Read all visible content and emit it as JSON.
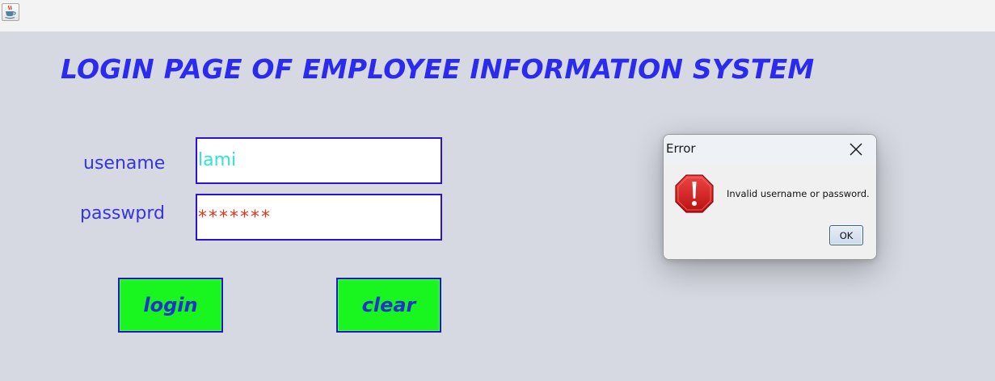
{
  "window": {
    "app_icon": "java-cup-icon"
  },
  "form": {
    "title": "LOGIN PAGE OF EMPLOYEE INFORMATION SYSTEM",
    "username_label": "usename",
    "username_value": "lami",
    "password_label": "passwprd",
    "password_value": "*******",
    "login_label": "login",
    "clear_label": "clear"
  },
  "dialog": {
    "title": "Error",
    "message": "Invalid username or password.",
    "ok_label": "OK",
    "icon": "error-exclamation-icon",
    "close_icon": "close-icon"
  },
  "colors": {
    "title": "#2b2bf0",
    "button_bg": "#19f51f",
    "button_text": "#2233cc",
    "field_border": "#2a13d6",
    "username_text": "#2ee6cf",
    "password_text": "#e8341c",
    "error_icon": "#d01919",
    "background": "#d6d9e2"
  }
}
